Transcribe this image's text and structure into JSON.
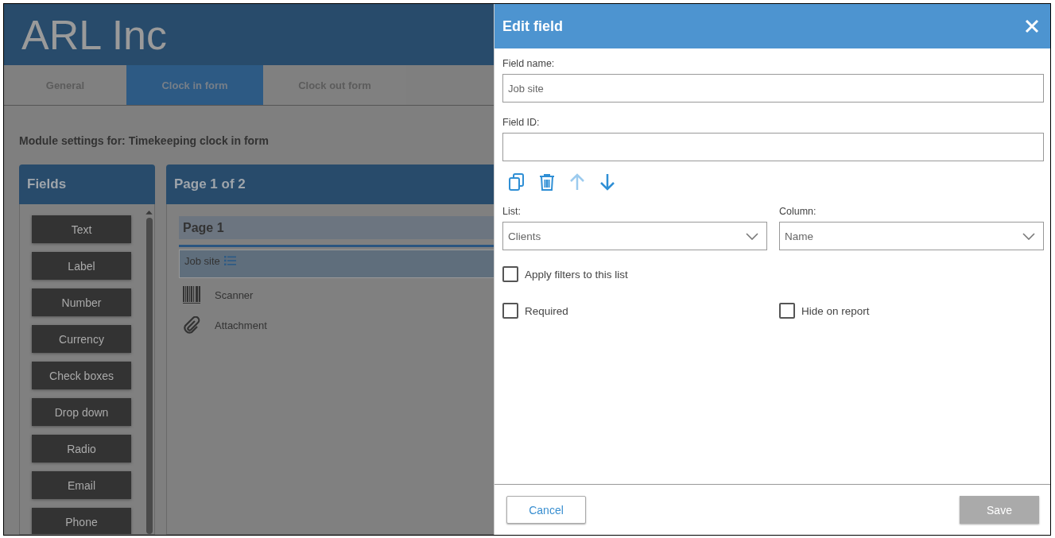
{
  "header": {
    "title": "ARL Inc"
  },
  "tabs": [
    {
      "label": "General",
      "selected": false
    },
    {
      "label": "Clock in form",
      "selected": true
    },
    {
      "label": "Clock out form",
      "selected": false
    }
  ],
  "module_settings": "Module settings for: Timekeeping clock in form",
  "fields_panel": {
    "title": "Fields",
    "items": [
      "Text",
      "Label",
      "Number",
      "Currency",
      "Check boxes",
      "Drop down",
      "Radio",
      "Email",
      "Phone"
    ]
  },
  "page_panel": {
    "title": "Page 1 of 2",
    "page_label": "Page 1",
    "fields": [
      {
        "kind": "list",
        "label": "Job site",
        "selected": true
      },
      {
        "kind": "scanner",
        "label": "Scanner",
        "selected": false
      },
      {
        "kind": "attachment",
        "label": "Attachment",
        "selected": false
      }
    ]
  },
  "dialog": {
    "title": "Edit field",
    "field_name": {
      "label": "Field name:",
      "value": "Job site"
    },
    "field_id": {
      "label": "Field ID:"
    },
    "actions": [
      {
        "kind": "copy",
        "disabled": false
      },
      {
        "kind": "delete",
        "disabled": false
      },
      {
        "kind": "up",
        "disabled": true
      },
      {
        "kind": "down",
        "disabled": false
      }
    ],
    "list": {
      "label": "List:",
      "value": "Clients"
    },
    "column": {
      "label": "Column:",
      "value": "Name"
    },
    "checkbox_rows": [
      [
        {
          "label": "Apply filters to this list",
          "checked": false
        }
      ],
      [
        {
          "label": "Required",
          "checked": false
        },
        {
          "label": "Hide on report",
          "checked": false
        }
      ]
    ],
    "cancel": "Cancel",
    "save": {
      "label": "Save",
      "disabled": true
    }
  }
}
